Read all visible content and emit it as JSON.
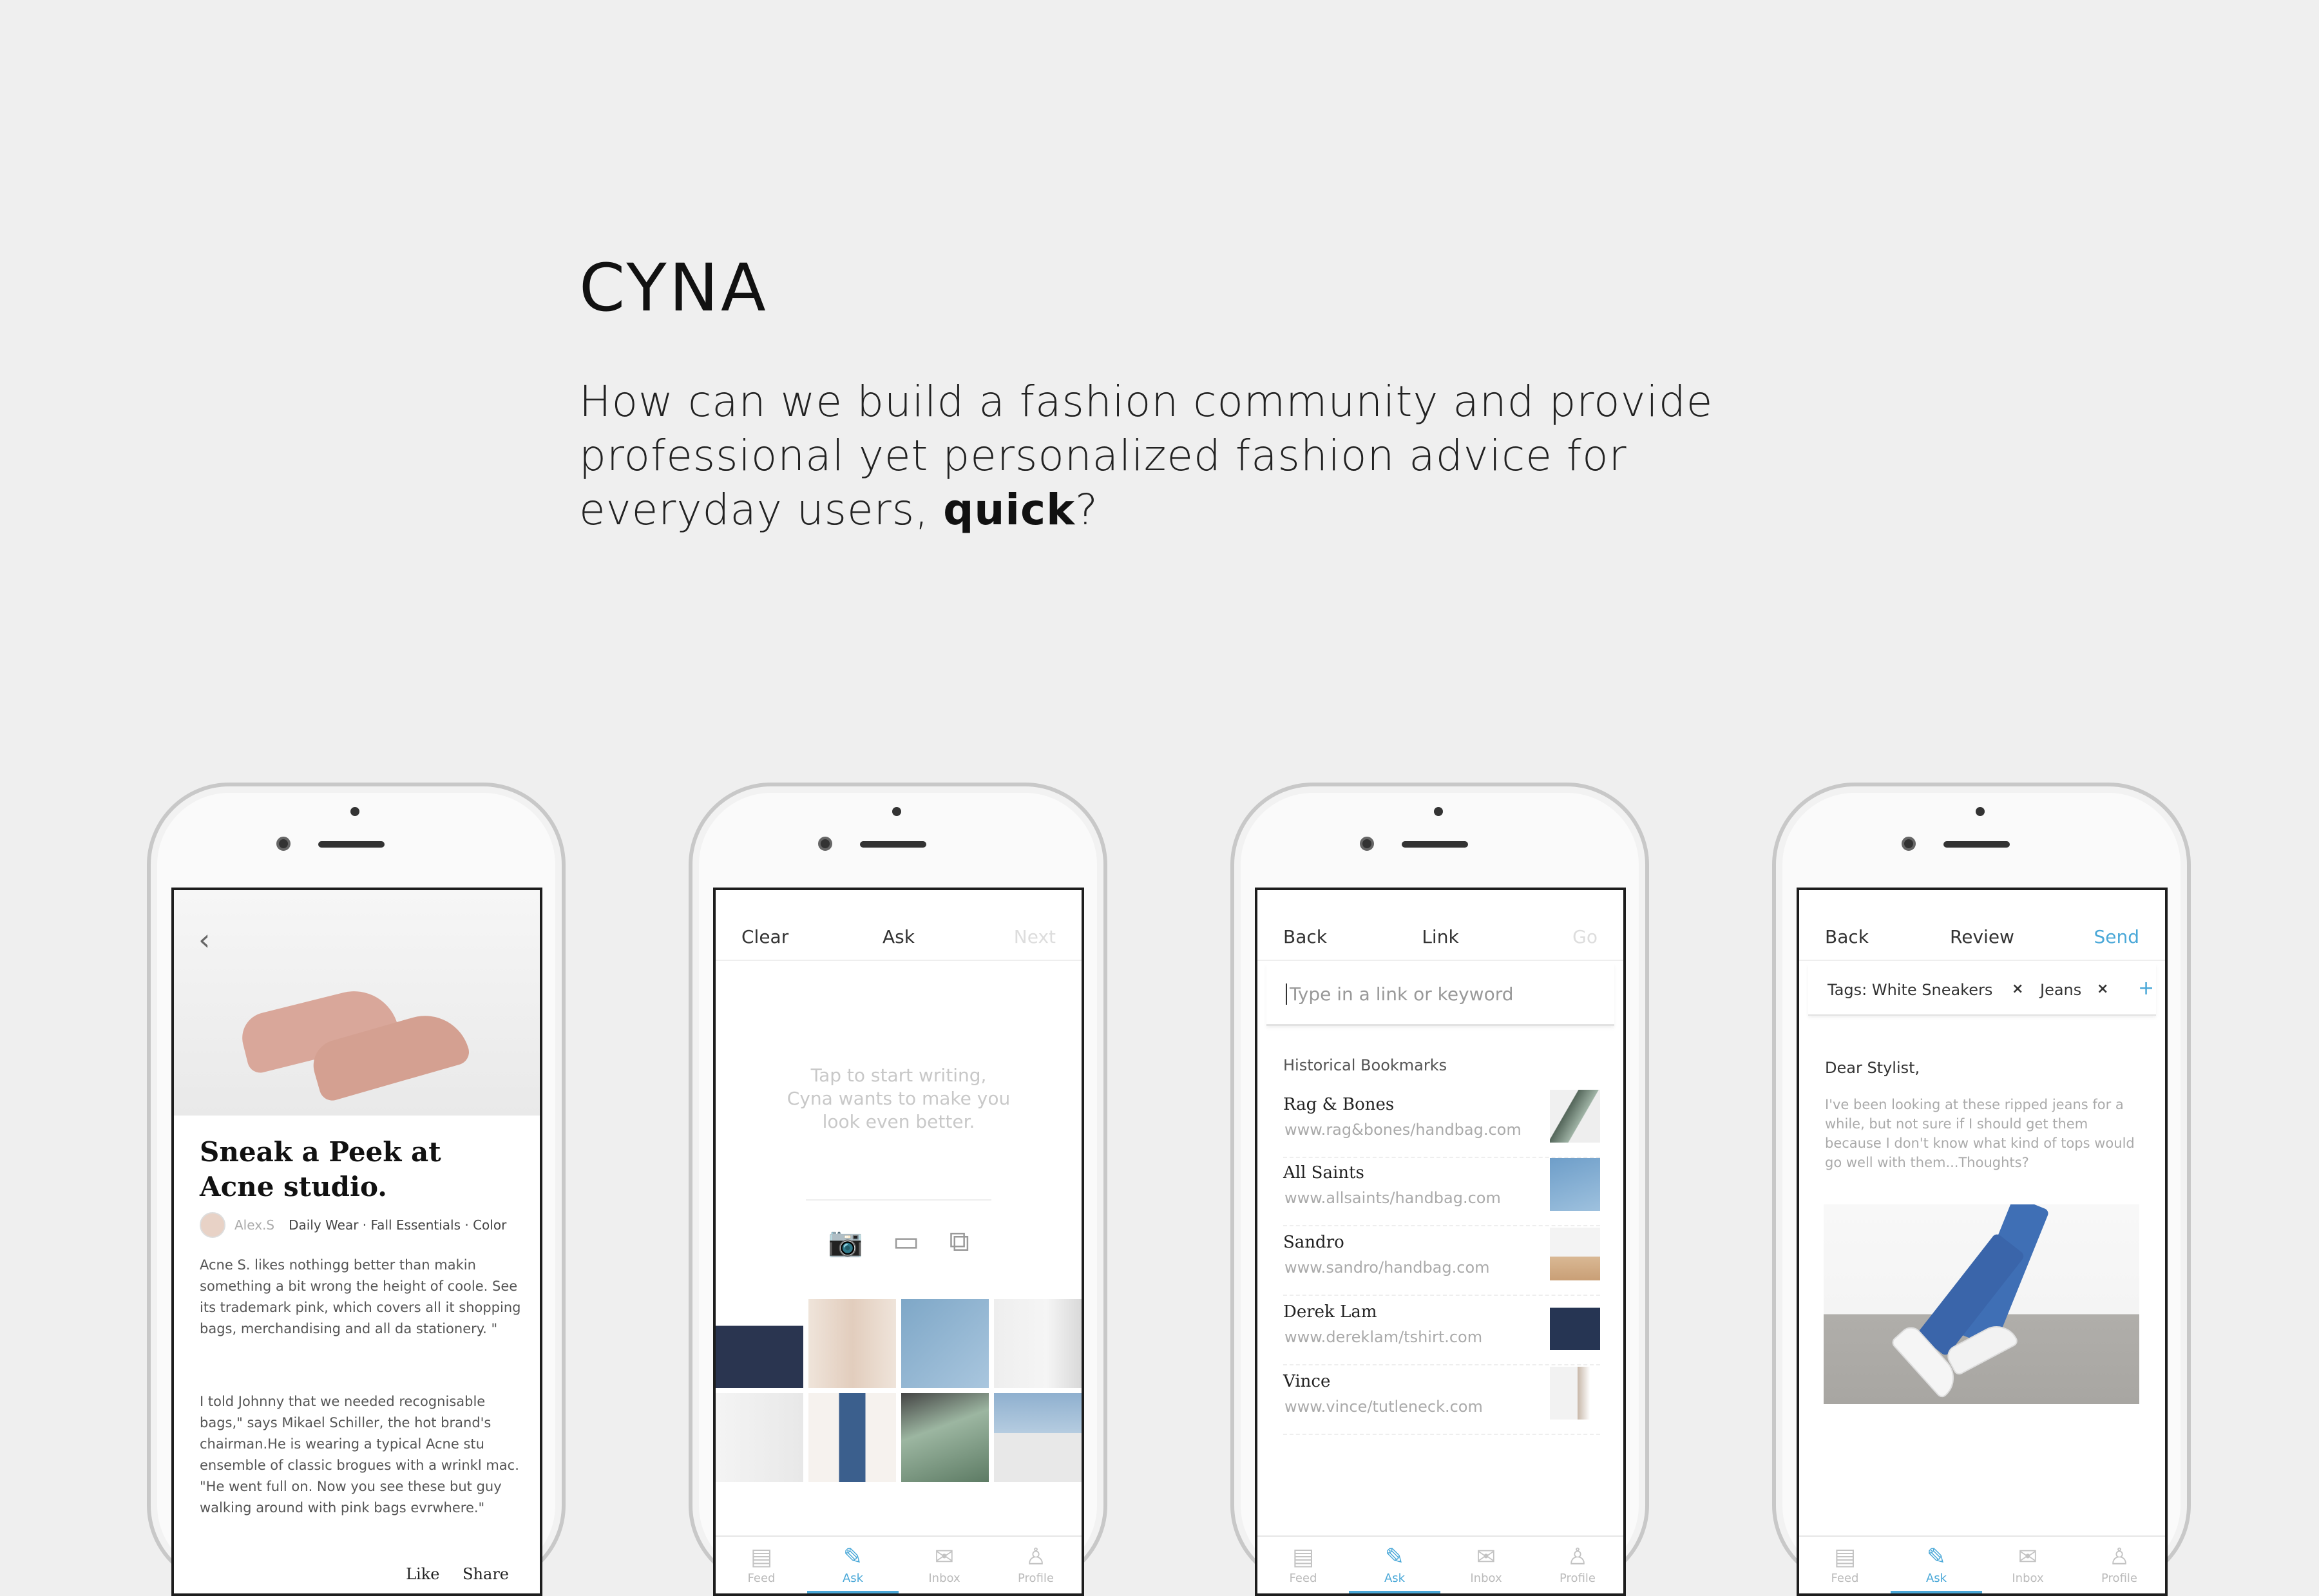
{
  "brand": "CYNA",
  "tagline": {
    "pre": "How can we build a fashion community and provide professional yet personalized fashion advice for everyday users, ",
    "bold": "quick",
    "post": "?"
  },
  "tabs": [
    {
      "label": "Feed",
      "icon": "feed-icon"
    },
    {
      "label": "Ask",
      "icon": "pencil-icon"
    },
    {
      "label": "Inbox",
      "icon": "mail-icon"
    },
    {
      "label": "Profile",
      "icon": "person-icon"
    }
  ],
  "screen1": {
    "title": "Sneak a Peek at Acne studio.",
    "author": "Alex.S",
    "categories": "Daily Wear · Fall Essentials · Color",
    "para1": "Acne S. likes nothingg better than makin something a bit wrong the height of coole. See its trademark pink, which covers all it shopping bags, merchandising and all da stationery. \"",
    "para2": "I told Johnny that we needed recognisable bags,\" says Mikael Schiller, the hot brand's chairman.He is wearing a typical Acne stu ensemble of classic brogues with a wrinkl mac. \"He went full on. Now you see these but guy walking around with pink bags evrwhere.\"",
    "like": "Like",
    "share": "Share"
  },
  "screen2": {
    "left": "Clear",
    "title": "Ask",
    "right": "Next",
    "placeholder_1": "Tap to start writing,",
    "placeholder_2": "Cyna wants to make you",
    "placeholder_3": "look even better.",
    "media_icons": [
      "camera-icon",
      "image-icon",
      "link-icon"
    ]
  },
  "screen3": {
    "left": "Back",
    "title": "Link",
    "right": "Go",
    "search_placeholder": "Type in a link or keyword",
    "history_label": "Historical Bookmarks",
    "bookmarks": [
      {
        "name": "Rag & Bones",
        "url": "www.rag&bones/handbag.com"
      },
      {
        "name": "All Saints",
        "url": "www.allsaints/handbag.com"
      },
      {
        "name": "Sandro",
        "url": "www.sandro/handbag.com"
      },
      {
        "name": "Derek Lam",
        "url": "www.dereklam/tshirt.com"
      },
      {
        "name": "Vince",
        "url": "www.vince/tutleneck.com"
      }
    ]
  },
  "screen4": {
    "left": "Back",
    "title": "Review",
    "right": "Send",
    "tag1": "Tags: White Sneakers",
    "tag2": "Jeans",
    "remove": "×",
    "add": "+",
    "greeting": "Dear Stylist,",
    "message": "I've been looking at these ripped jeans for a while, but not sure if I should get them because I don't know what kind of tops would go well with them...Thoughts?"
  },
  "colors": {
    "accent": "#4aa8d8",
    "background": "#efefef"
  }
}
